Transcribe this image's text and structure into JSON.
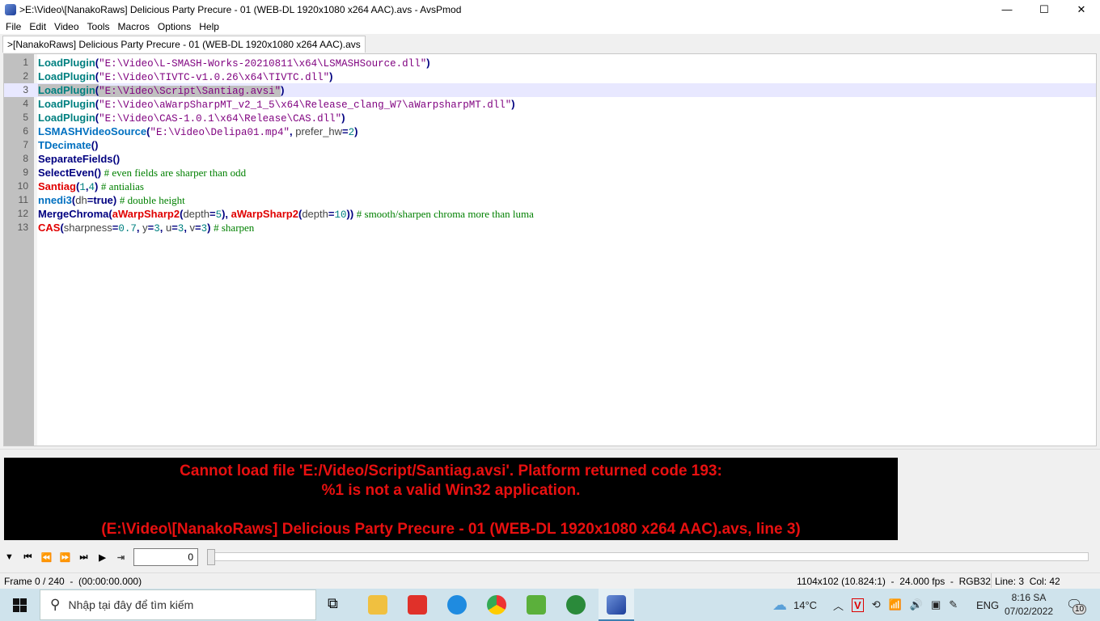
{
  "window": {
    "title": ">E:\\Video\\[NanakoRaws] Delicious Party Precure - 01 (WEB-DL 1920x1080 x264 AAC).avs - AvsPmod",
    "minimize": "—",
    "maximize": "☐",
    "close": "✕"
  },
  "menu": [
    "File",
    "Edit",
    "Video",
    "Tools",
    "Macros",
    "Options",
    "Help"
  ],
  "tab": {
    "label": ">[NanakoRaws] Delicious Party Precure - 01 (WEB-DL 1920x1080 x264 AAC).avs"
  },
  "editor": {
    "current_line": 3,
    "lines": [
      [
        [
          "t-plugin",
          "LoadPlugin"
        ],
        [
          "t-op",
          "("
        ],
        [
          "t-str",
          "\"E:\\Video\\L-SMASH-Works-20210811\\x64\\LSMASHSource.dll\""
        ],
        [
          "t-op",
          ")"
        ]
      ],
      [
        [
          "t-plugin",
          "LoadPlugin"
        ],
        [
          "t-op",
          "("
        ],
        [
          "t-str",
          "\"E:\\Video\\TIVTC-v1.0.26\\x64\\TIVTC.dll\""
        ],
        [
          "t-op",
          ")"
        ]
      ],
      [
        [
          "t-plugin sel",
          "LoadPlugin"
        ],
        [
          "t-op sel",
          "("
        ],
        [
          "t-str sel",
          "\"E:\\Video\\Script\\Santiag.avsi\""
        ],
        [
          "t-op",
          ")"
        ]
      ],
      [
        [
          "t-plugin",
          "LoadPlugin"
        ],
        [
          "t-op",
          "("
        ],
        [
          "t-str",
          "\"E:\\Video\\aWarpSharpMT_v2_1_5\\x64\\Release_clang_W7\\aWarpsharpMT.dll\""
        ],
        [
          "t-op",
          ")"
        ]
      ],
      [
        [
          "t-plugin",
          "LoadPlugin"
        ],
        [
          "t-op",
          "("
        ],
        [
          "t-str",
          "\"E:\\Video\\CAS-1.0.1\\x64\\Release\\CAS.dll\""
        ],
        [
          "t-op",
          ")"
        ]
      ],
      [
        [
          "t-internal",
          "LSMASHVideoSource"
        ],
        [
          "t-op",
          "("
        ],
        [
          "t-str",
          "\"E:\\Video\\Delipa01.mp4\""
        ],
        [
          "t-op",
          ", "
        ],
        [
          "t-param",
          "prefer_hw"
        ],
        [
          "t-op",
          "="
        ],
        [
          "t-num",
          "2"
        ],
        [
          "t-op",
          ")"
        ]
      ],
      [
        [
          "t-internal",
          "TDecimate"
        ],
        [
          "t-op",
          "()"
        ]
      ],
      [
        [
          "t-core",
          "SeparateFields"
        ],
        [
          "t-op",
          "()"
        ]
      ],
      [
        [
          "t-core",
          "SelectEven"
        ],
        [
          "t-op",
          "() "
        ],
        [
          "t-com",
          "# even fields are sharper than odd"
        ]
      ],
      [
        [
          "t-user",
          "Santiag"
        ],
        [
          "t-op",
          "("
        ],
        [
          "t-num",
          "1"
        ],
        [
          "t-op",
          ","
        ],
        [
          "t-num",
          "4"
        ],
        [
          "t-op",
          ") "
        ],
        [
          "t-com",
          "# antialias"
        ]
      ],
      [
        [
          "t-internal",
          "nnedi3"
        ],
        [
          "t-op",
          "("
        ],
        [
          "t-param",
          "dh"
        ],
        [
          "t-op",
          "="
        ],
        [
          "t-kw",
          "true"
        ],
        [
          "t-op",
          ") "
        ],
        [
          "t-com",
          "# double height"
        ]
      ],
      [
        [
          "t-core",
          "MergeChroma"
        ],
        [
          "t-op",
          "("
        ],
        [
          "t-user",
          "aWarpSharp2"
        ],
        [
          "t-op",
          "("
        ],
        [
          "t-param",
          "depth"
        ],
        [
          "t-op",
          "="
        ],
        [
          "t-num",
          "5"
        ],
        [
          "t-op",
          "), "
        ],
        [
          "t-user",
          "aWarpSharp2"
        ],
        [
          "t-op",
          "("
        ],
        [
          "t-param",
          "depth"
        ],
        [
          "t-op",
          "="
        ],
        [
          "t-num",
          "10"
        ],
        [
          "t-op",
          ")) "
        ],
        [
          "t-com",
          "# smooth/sharpen chroma more than luma"
        ]
      ],
      [
        [
          "t-user",
          "CAS"
        ],
        [
          "t-op",
          "("
        ],
        [
          "t-param",
          "sharpness"
        ],
        [
          "t-op",
          "="
        ],
        [
          "t-num",
          "0.7"
        ],
        [
          "t-op",
          ", "
        ],
        [
          "t-param",
          "y"
        ],
        [
          "t-op",
          "="
        ],
        [
          "t-num",
          "3"
        ],
        [
          "t-op",
          ", "
        ],
        [
          "t-param",
          "u"
        ],
        [
          "t-op",
          "="
        ],
        [
          "t-num",
          "3"
        ],
        [
          "t-op",
          ", "
        ],
        [
          "t-param",
          "v"
        ],
        [
          "t-op",
          "="
        ],
        [
          "t-num",
          "3"
        ],
        [
          "t-op",
          ") "
        ],
        [
          "t-com",
          "# sharpen"
        ]
      ]
    ]
  },
  "error": {
    "line1": "Cannot load file 'E:/Video/Script/Santiag.avsi'. Platform returned code 193:",
    "line2": "%1 is not a valid Win32 application.",
    "line3": "(E:\\Video\\[NanakoRaws] Delicious Party Precure - 01 (WEB-DL 1920x1080 x264 AAC).avs, line 3)"
  },
  "toolbar": {
    "frame_value": "0",
    "position": 0
  },
  "status": {
    "frame": "Frame 0 / 240  -  (00:00:00.000)",
    "video_info": "1104x102 (10.824:1)  -  24.000 fps  -  RGB32",
    "cursor": "Line: 3  Col: 42"
  },
  "taskbar": {
    "search_placeholder": "Nhập tại đây để tìm kiếm",
    "temperature": "14°C",
    "language": "ENG",
    "time": "8:16 SA",
    "date": "07/02/2022",
    "notifications": "10"
  }
}
